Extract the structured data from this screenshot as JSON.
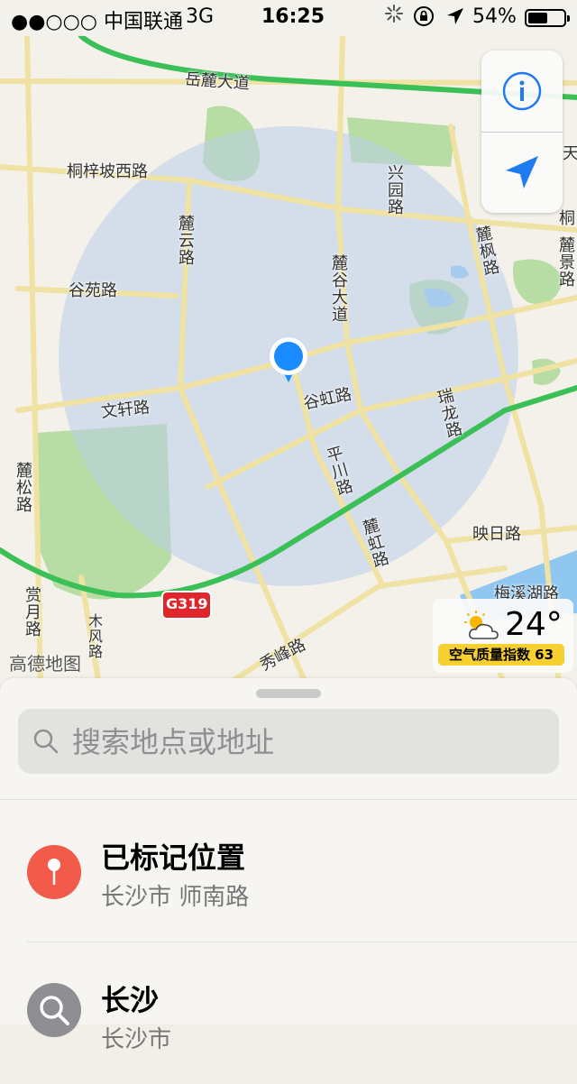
{
  "status_bar": {
    "carrier": "●●○○○ 中国联通",
    "network": "3G",
    "time": "16:25",
    "battery_percent": "54%",
    "battery_level": 0.54
  },
  "map": {
    "labels": {
      "yuelu_avenue": "岳麓大道",
      "tongzipo_west_road": "桐梓坡西路",
      "luyun_road": "麓云路",
      "xingtong_road": "兴园路",
      "lugu_avenue": "麓谷大道",
      "lufeng_road": "麓枫路",
      "lujing_road": "麓景路",
      "tong_partial": "桐",
      "tian_partial": "天",
      "guyuan_road": "谷苑路",
      "wenxuan_road": "文轩路",
      "guhong_road": "谷虹路",
      "ruilong_road": "瑞龙路",
      "pingchuan_road": "平川路",
      "lusong_road": "麓松路",
      "luhong_road": "麓虹路",
      "yingri_road": "映日路",
      "meixihu_road": "梅溪湖路",
      "shangyue_road": "赏月路",
      "mufeng_road": "木风路",
      "xiufeng_road": "秀峰路",
      "highway_shield": "G319"
    },
    "logo": "高德地图",
    "colors": {
      "accuracy_circle": "#b9cdea",
      "location_pin": "#1a8cff",
      "highway": "#3bbf57",
      "road": "#f5e7a0",
      "green": "#b8dda4",
      "water": "#8fc7f0"
    }
  },
  "controls": {
    "info_icon": "info-icon",
    "locate_icon": "location-arrow-icon",
    "accent": "#1f7bf2"
  },
  "weather": {
    "temperature": "24°",
    "aqi_label": "空气质量指数 63"
  },
  "sheet": {
    "search_placeholder": "搜索地点或地址",
    "items": [
      {
        "title": "已标记位置",
        "subtitle": "长沙市 师南路",
        "icon": "pin-icon",
        "color": "#f25a4a"
      },
      {
        "title": "长沙",
        "subtitle": "长沙市",
        "icon": "search-icon",
        "color": "#8e8e93"
      }
    ]
  }
}
